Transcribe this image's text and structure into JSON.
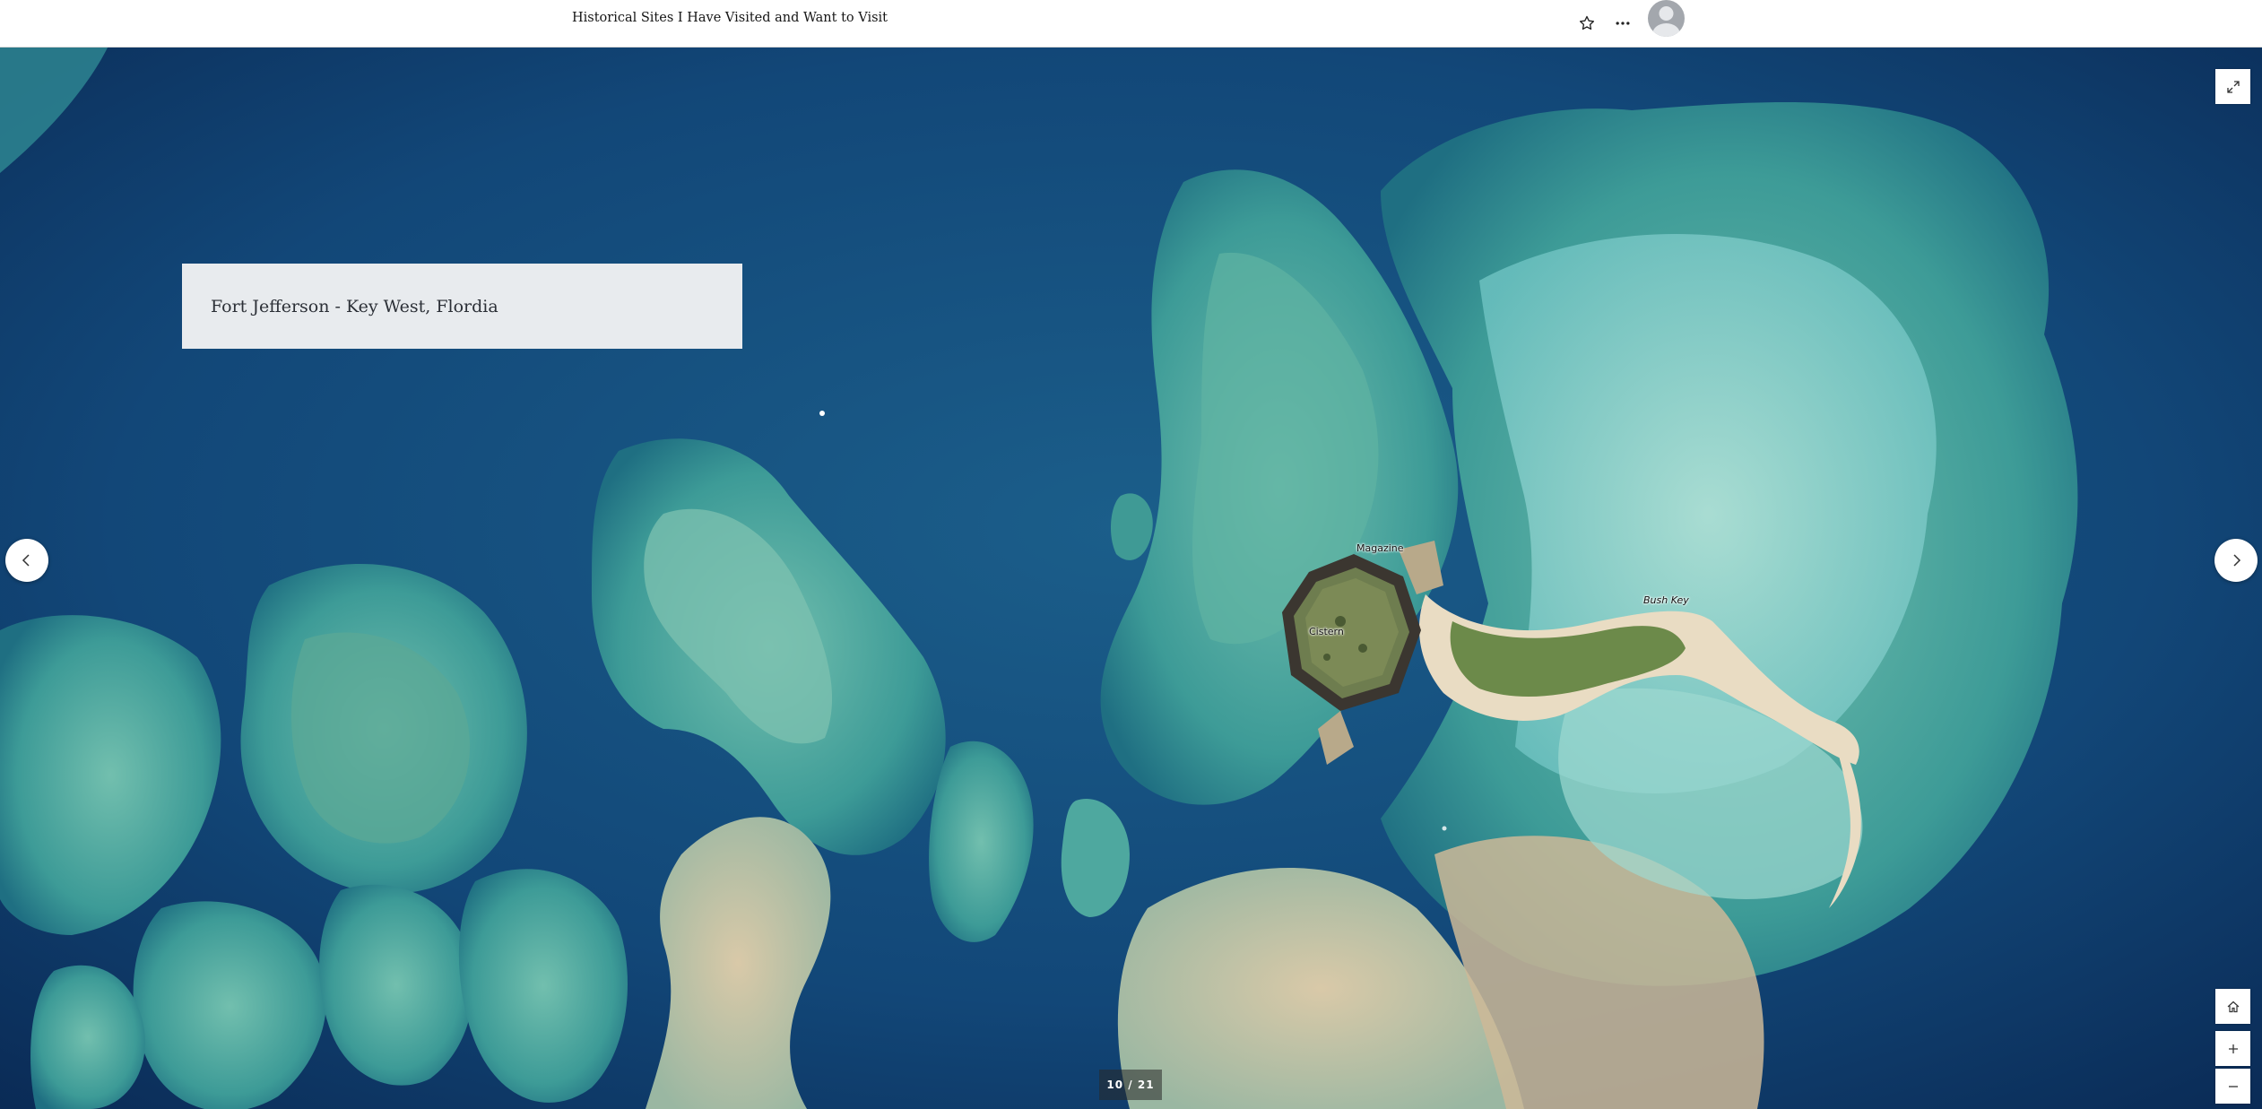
{
  "header": {
    "story_title": "Historical Sites I Have Visited and Want to Visit"
  },
  "icons": {
    "favorite": "star-icon",
    "more": "more-options-icon",
    "avatar": "user-avatar-icon",
    "fullscreen": "expand-icon",
    "home": "home-icon",
    "zoom_in": "plus-icon",
    "zoom_out": "minus-icon",
    "prev": "chevron-left-icon",
    "next": "chevron-right-icon"
  },
  "slide": {
    "title": "Fort Jefferson - Key West, Flordia"
  },
  "map_labels": {
    "magazine": "Magazine",
    "cistern": "Cistern",
    "bush_key": "Bush Key"
  },
  "counter": {
    "text": "10  /  21"
  },
  "colors": {
    "deep_water": "#0d3360",
    "reef": "#3fa6a4",
    "shallow": "#7cc9c4",
    "sand": "#e9dcc3",
    "vegetation": "#5e7a45"
  }
}
